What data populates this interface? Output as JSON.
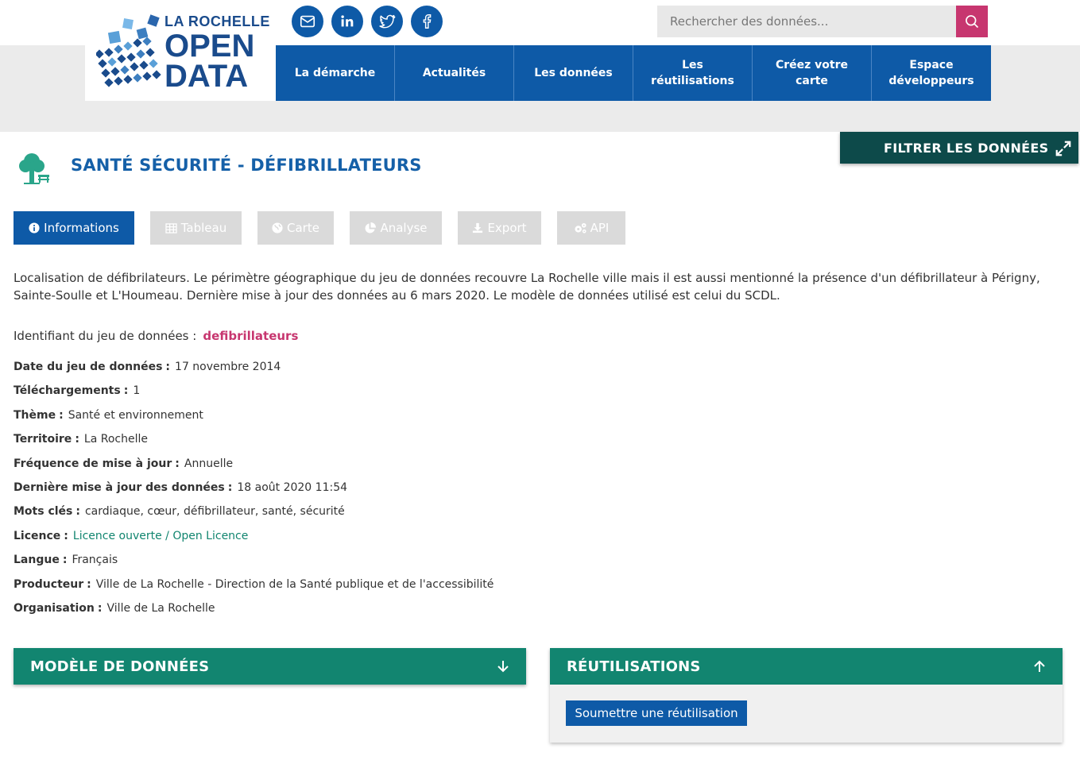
{
  "logo": {
    "line1": "LA ROCHELLE",
    "line2": "OPEN",
    "line3": "DATA"
  },
  "social": [
    {
      "name": "mail-icon"
    },
    {
      "name": "linkedin-icon"
    },
    {
      "name": "twitter-icon"
    },
    {
      "name": "facebook-icon"
    }
  ],
  "search": {
    "placeholder": "Rechercher des données..."
  },
  "nav": [
    "La démarche",
    "Actualités",
    "Les données",
    "Les réutilisations",
    "Créez votre carte",
    "Espace développeurs"
  ],
  "filter": {
    "label": "FILTRER LES DONNÉES"
  },
  "dataset": {
    "title": "SANTÉ SÉCURITÉ - DÉFIBRILLATEURS"
  },
  "tabs": [
    {
      "label": "Informations",
      "icon": "info-icon"
    },
    {
      "label": "Tableau",
      "icon": "table-icon"
    },
    {
      "label": "Carte",
      "icon": "globe-icon"
    },
    {
      "label": "Analyse",
      "icon": "pie-chart-icon"
    },
    {
      "label": "Export",
      "icon": "download-icon"
    },
    {
      "label": "API",
      "icon": "cogs-icon"
    }
  ],
  "description": "Localisation de défibrilateurs. Le périmètre géographique du jeu de données recouvre La Rochelle ville mais il est aussi mentionné la présence d'un défibrillateur à Périgny, Sainte-Soulle et L'Houmeau. Dernière mise à jour des données au 6 mars 2020. Le modèle de données utilisé est celui du SCDL.",
  "identifier": {
    "label": "Identifiant du jeu de données :",
    "value": "defibrillateurs"
  },
  "meta": [
    {
      "key": "Date du jeu de données",
      "value": "17 novembre 2014"
    },
    {
      "key": "Téléchargements",
      "value": "1"
    },
    {
      "key": "Thème",
      "value": "Santé et environnement"
    },
    {
      "key": "Territoire",
      "value": "La Rochelle"
    },
    {
      "key": "Fréquence de mise à jour",
      "value": "Annuelle"
    },
    {
      "key": "Dernière mise à jour des données",
      "value": "18 août 2020 11:54"
    },
    {
      "key": "Mots clés",
      "value": "cardiaque, cœur, défibrillateur, santé, sécurité"
    },
    {
      "key": "Licence",
      "value": "Licence ouverte / Open Licence"
    },
    {
      "key": "Langue",
      "value": "Français"
    },
    {
      "key": "Producteur",
      "value": "Ville de La Rochelle - Direction de la Santé publique et de l'accessibilité"
    },
    {
      "key": "Organisation",
      "value": "Ville de La Rochelle"
    }
  ],
  "panels": {
    "model": {
      "title": "MODÈLE DE DONNÉES"
    },
    "reuse": {
      "title": "RÉUTILISATIONS",
      "button": "Soumettre une réutilisation"
    }
  },
  "colors": {
    "primary_blue": "#0e5aa7",
    "accent_pink": "#c7366f",
    "teal": "#128570",
    "dark_teal": "#0d4a4a"
  }
}
